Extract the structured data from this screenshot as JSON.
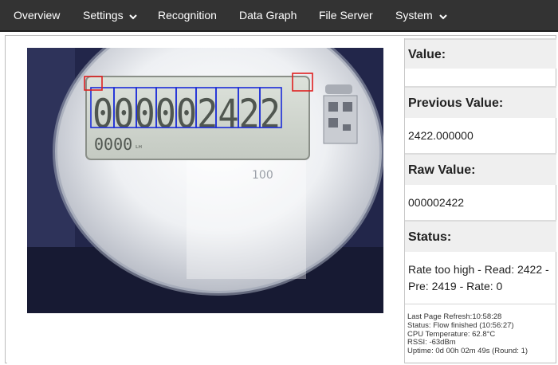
{
  "nav": {
    "items": [
      {
        "label": "Overview"
      },
      {
        "label": "Settings",
        "has_dropdown": true
      },
      {
        "label": "Recognition"
      },
      {
        "label": "Data Graph"
      },
      {
        "label": "File Server"
      },
      {
        "label": "System",
        "has_dropdown": true
      }
    ]
  },
  "camera": {
    "digits": "000002422",
    "counter_digits": "0000",
    "counter_unit": "ʟʜ",
    "bottom_text": "100"
  },
  "panel": {
    "value_label": "Value:",
    "value": "",
    "previous_label": "Previous Value:",
    "previous_value": "2422.000000",
    "raw_label": "Raw Value:",
    "raw_value": "000002422",
    "status_label": "Status:",
    "status_value": "Rate too high - Read: 2422 - Pre: 2419 - Rate: 0"
  },
  "info": {
    "last_refresh": "Last Page Refresh:10:58:28",
    "status": "Status: Flow finished (10:56:27)",
    "cpu_temp": "CPU Temperature: 62.8°C",
    "rssi": "RSSI: -63dBm",
    "uptime": "Uptime: 0d 00h 02m 49s (Round: 1)"
  },
  "colors": {
    "nav_bg": "#333333",
    "digit_box": "#1a2bd8",
    "ref_box": "#e02020"
  }
}
